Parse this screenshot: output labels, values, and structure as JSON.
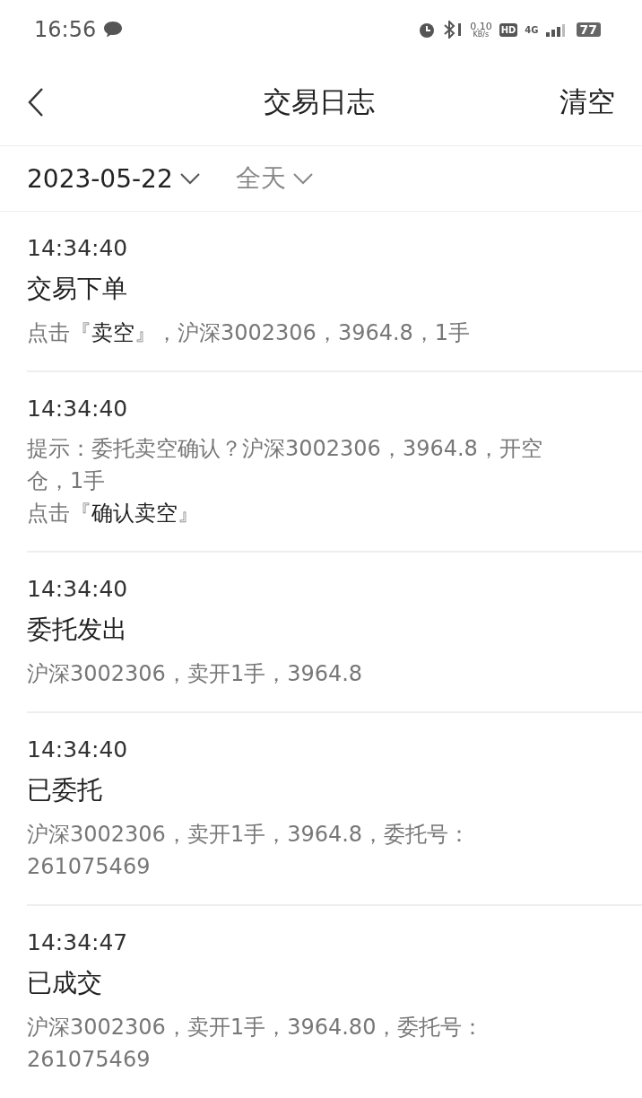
{
  "status_bar": {
    "time": "16:56",
    "net_speed": "0.10",
    "net_unit": "KB/s",
    "hd": "HD",
    "network": "4G",
    "battery": "77"
  },
  "header": {
    "title": "交易日志",
    "action": "清空"
  },
  "filters": [
    {
      "label": "2023-05-22",
      "kind": "date"
    },
    {
      "label": "全天",
      "kind": "range"
    }
  ],
  "entries": [
    {
      "time": "14:34:40",
      "title": "交易下单",
      "details": [
        "点击『**卖空**』，沪深3002306，3964.8，1手"
      ]
    },
    {
      "time": "14:34:40",
      "details": [
        "提示：委托卖空确认？沪深3002306，3964.8，开空仓，1手",
        "点击『**确认卖空**』"
      ]
    },
    {
      "time": "14:34:40",
      "title": "委托发出",
      "details": [
        "沪深3002306，卖开1手，3964.8"
      ]
    },
    {
      "time": "14:34:40",
      "title": "已委托",
      "details": [
        "沪深3002306，卖开1手，3964.8，委托号：261075469"
      ]
    },
    {
      "time": "14:34:47",
      "title": "已成交",
      "details": [
        "沪深3002306，卖开1手，3964.80，委托号：261075469"
      ]
    }
  ]
}
